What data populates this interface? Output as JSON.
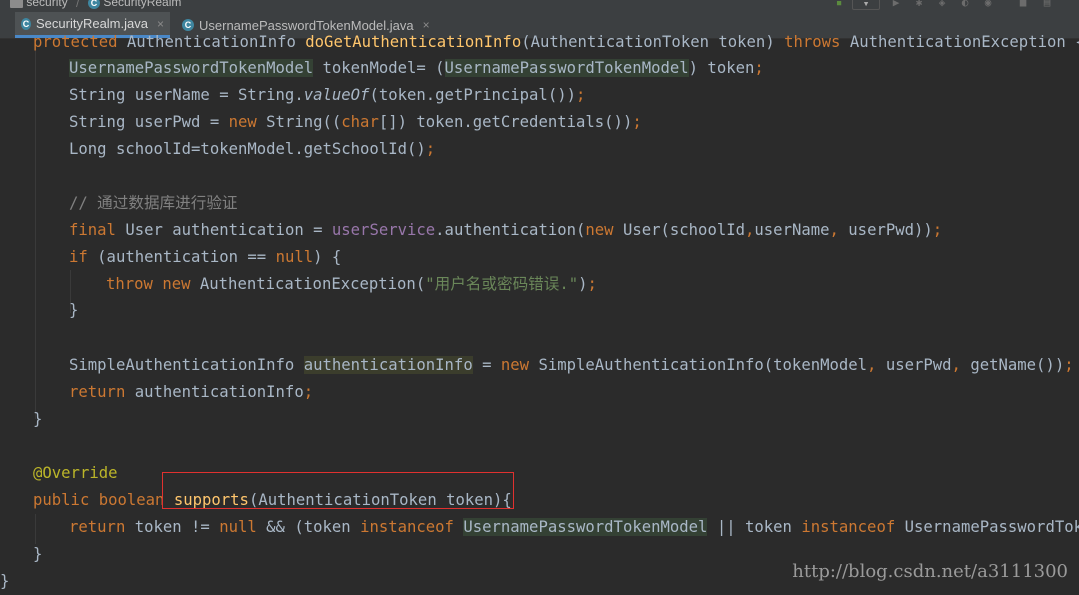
{
  "breadcrumb": {
    "project": "security",
    "file": "SecurityRealm"
  },
  "tabs": [
    {
      "label": "SecurityRealm.java",
      "active": true
    },
    {
      "label": "UsernamePasswordTokenModel.java",
      "active": false
    }
  ],
  "code": {
    "l0": {
      "a": "protected ",
      "b": "AuthenticationInfo ",
      "c": "doGetAuthenticationInfo",
      "d": "(AuthenticationToken token) ",
      "e": "throws ",
      "f": "AuthenticationException {"
    },
    "l1": {
      "a": "UsernamePasswordTokenModel",
      "b": " tokenModel= (",
      "c": "UsernamePasswordTokenModel",
      "d": ") token",
      "e": ";"
    },
    "l2": {
      "a": "String userName = String.",
      "b": "valueOf",
      "c": "(token.getPrincipal())",
      "d": ";"
    },
    "l3": {
      "a": "String userPwd = ",
      "b": "new ",
      "c": "String((",
      "d": "char",
      "e": "[]) token.getCredentials())",
      "f": ";"
    },
    "l4": {
      "a": "Long schoolId=tokenModel.getSchoolId()",
      "b": ";"
    },
    "l5": {
      "a": "// 通过数据库进行验证"
    },
    "l6": {
      "a": "final ",
      "b": "User authentication = ",
      "c": "userService",
      "d": ".authentication(",
      "e": "new ",
      "f": "User(schoolId",
      "g": ",",
      "h": "userName",
      "i": ", ",
      "j": "userPwd))",
      "k": ";"
    },
    "l7": {
      "a": "if ",
      "b": "(authentication == ",
      "c": "null",
      "d": ") {"
    },
    "l8": {
      "a": "throw new ",
      "b": "AuthenticationException(",
      "c": "\"用户名或密码错误.\"",
      "d": ")",
      "e": ";"
    },
    "l9": {
      "a": "}"
    },
    "l10": {
      "a": "SimpleAuthenticationInfo ",
      "b": "authenticationInfo",
      "c": " = ",
      "d": "new ",
      "e": "SimpleAuthenticationInfo(tokenModel",
      "f": ", ",
      "g": "userPwd",
      "h": ", ",
      "i": "getName())",
      "j": ";"
    },
    "l11": {
      "a": "return ",
      "b": "authenticationInfo",
      "c": ";"
    },
    "l12": {
      "a": "}"
    },
    "l13": {
      "a": "@Override"
    },
    "l14": {
      "a": "public boolean ",
      "b": "supports",
      "c": "(AuthenticationToken token){"
    },
    "l15": {
      "a": "return ",
      "b": "token != ",
      "c": "null ",
      "d": "&& (token ",
      "e": "instanceof ",
      "f": "UsernamePasswordTokenModel",
      "g": " || token ",
      "h": "instanceof ",
      "i": "UsernamePasswordToken)",
      "j": ";"
    },
    "l16": {
      "a": "}"
    },
    "l17": {
      "a": "}"
    }
  },
  "watermark": "http://blog.csdn.net/a3111300",
  "colors": {
    "background": "#2b2b2b",
    "keyword": "#cc7832",
    "string": "#6a8759",
    "comment": "#808080",
    "annotation": "#bbb529",
    "field": "#9876aa",
    "highlight_box": "#e0312f"
  }
}
